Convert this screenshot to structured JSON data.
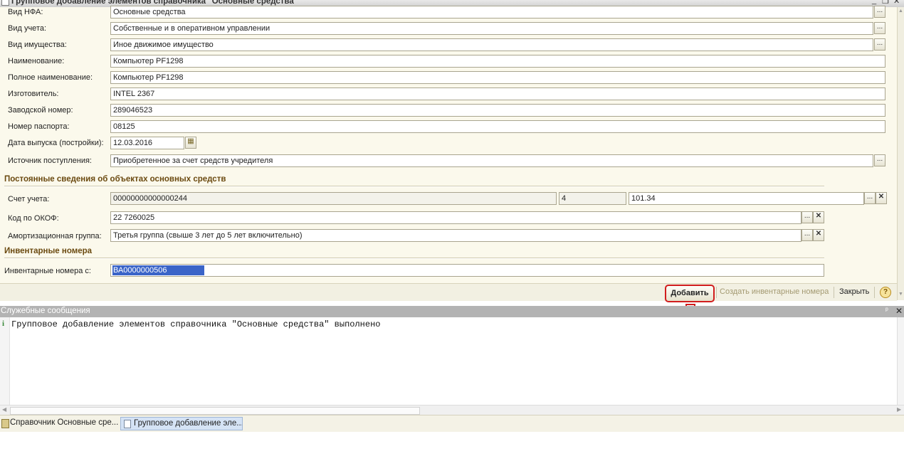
{
  "window": {
    "title": "Групповое добавление элементов справочника \"Основные средства\"",
    "min": "_",
    "restore": "❐",
    "close": "✕"
  },
  "fields": {
    "vid_nfa": {
      "label": "Вид НФА:",
      "value": "Основные средства"
    },
    "vid_ucheta": {
      "label": "Вид учета:",
      "value": "Собственные и в оперативном управлении"
    },
    "vid_imushchestva": {
      "label": "Вид имущества:",
      "value": "Иное движимое имущество"
    },
    "naimenovanie": {
      "label": "Наименование:",
      "value": "Компьютер PF1298"
    },
    "polnoe_naimenovanie": {
      "label": "Полное наименование:",
      "value": "Компьютер PF1298"
    },
    "izgotovitel": {
      "label": "Изготовитель:",
      "value": "INTEL 2367"
    },
    "zavodskoy_nomer": {
      "label": "Заводской номер:",
      "value": "289046523"
    },
    "nomer_pasporta": {
      "label": "Номер паспорта:",
      "value": "08125"
    },
    "data_vypuska": {
      "label": "Дата выпуска (постройки):",
      "value": "12.03.2016"
    },
    "istochnik": {
      "label": "Источник поступления:",
      "value": "Приобретенное за счет средств учредителя"
    }
  },
  "section_constant": {
    "title": "Постоянные сведения об объектах основных средств",
    "schet_ucheta": {
      "label": "Счет учета:",
      "part1": "00000000000000244",
      "part2": "4",
      "part3": "101.34"
    },
    "kod_okof": {
      "label": "Код по ОКОФ:",
      "value": "22 7260025"
    },
    "amort_gruppa": {
      "label": "Амортизационная группа:",
      "value": "Третья группа (свыше 3 лет до 5 лет включительно)"
    }
  },
  "section_inventory": {
    "title": "Инвентарные номера",
    "start": {
      "label": "Инвентарные номера с:",
      "value": "ВА0000000506"
    }
  },
  "toolbar": {
    "add_label": "Добавить",
    "create_inventory_label": "Создать инвентарные номера",
    "close_label": "Закрыть",
    "help": "?"
  },
  "messages": {
    "title": "Служебные сообщения",
    "info_icon": "i",
    "text": "Групповое добавление элементов справочника \"Основные средства\" выполнено",
    "pin": "ᵖ",
    "close": "✕"
  },
  "taskbar": {
    "items": [
      {
        "label": "Справочник Основные сре..."
      },
      {
        "label": "Групповое добавление эле..."
      }
    ]
  },
  "icons": {
    "ellipsis": "...",
    "clear": "✕",
    "calendar": "▦"
  },
  "colors": {
    "accent_red": "#d11d1d",
    "section_title": "#6b4a10",
    "form_bg": "#fbf9ec",
    "selection": "#3a64c8"
  }
}
